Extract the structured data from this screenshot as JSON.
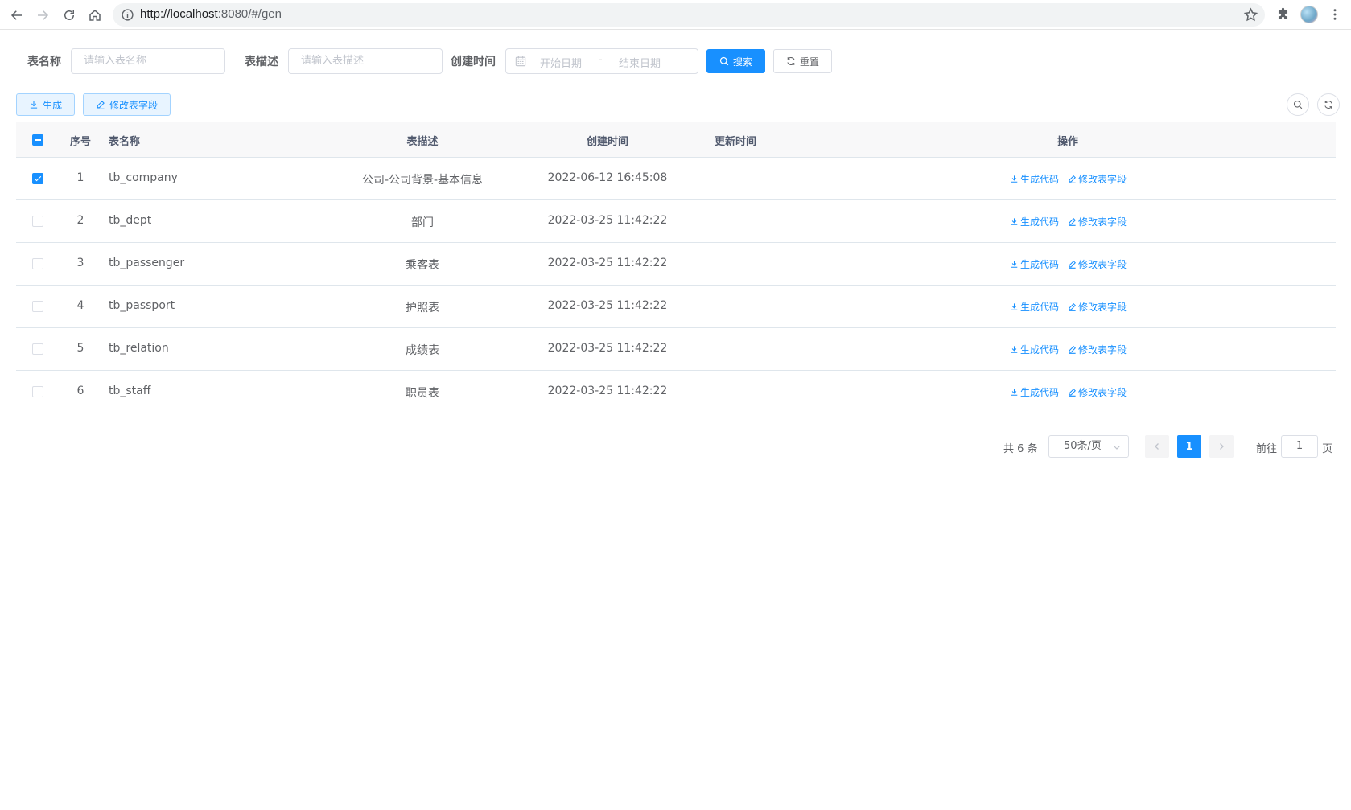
{
  "browser": {
    "url_host": "http://localhost",
    "url_rest": ":8080/#/gen"
  },
  "search": {
    "table_name_label": "表名称",
    "table_name_placeholder": "请输入表名称",
    "table_desc_label": "表描述",
    "table_desc_placeholder": "请输入表描述",
    "create_time_label": "创建时间",
    "start_date_placeholder": "开始日期",
    "range_separator": "-",
    "end_date_placeholder": "结束日期",
    "search_button": "搜索",
    "reset_button": "重置"
  },
  "toolbar": {
    "generate_button": "生成",
    "edit_fields_button": "修改表字段"
  },
  "table": {
    "headers": {
      "index": "序号",
      "table_name": "表名称",
      "table_desc": "表描述",
      "create_time": "创建时间",
      "update_time": "更新时间",
      "actions": "操作"
    },
    "rows": [
      {
        "index": "1",
        "table_name": "tb_company",
        "table_desc": "公司-公司背景-基本信息",
        "create_time": "2022-06-12 16:45:08",
        "update_time": "",
        "checked": true
      },
      {
        "index": "2",
        "table_name": "tb_dept",
        "table_desc": "部门",
        "create_time": "2022-03-25 11:42:22",
        "update_time": "",
        "checked": false
      },
      {
        "index": "3",
        "table_name": "tb_passenger",
        "table_desc": "乘客表",
        "create_time": "2022-03-25 11:42:22",
        "update_time": "",
        "checked": false
      },
      {
        "index": "4",
        "table_name": "tb_passport",
        "table_desc": "护照表",
        "create_time": "2022-03-25 11:42:22",
        "update_time": "",
        "checked": false
      },
      {
        "index": "5",
        "table_name": "tb_relation",
        "table_desc": "成绩表",
        "create_time": "2022-03-25 11:42:22",
        "update_time": "",
        "checked": false
      },
      {
        "index": "6",
        "table_name": "tb_staff",
        "table_desc": "职员表",
        "create_time": "2022-03-25 11:42:22",
        "update_time": "",
        "checked": false
      }
    ],
    "action_generate": "生成代码",
    "action_edit": "修改表字段"
  },
  "pagination": {
    "total_text": "共 6 条",
    "page_size": "50条/页",
    "current_page": "1",
    "goto_prefix": "前往",
    "goto_value": "1",
    "goto_suffix": "页"
  },
  "colors": {
    "primary": "#1890ff",
    "header_bg": "#f8f8f9",
    "border": "#dfe6ec"
  }
}
